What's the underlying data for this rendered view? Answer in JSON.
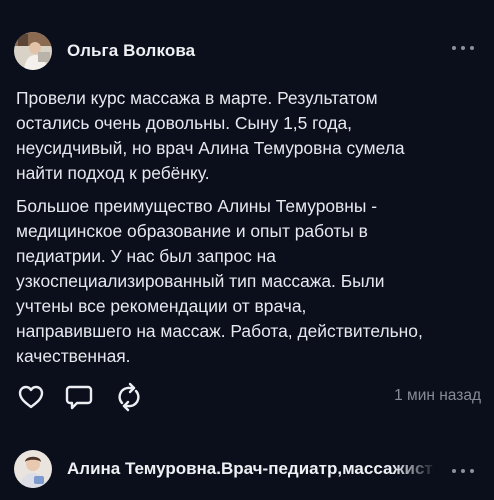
{
  "post": {
    "author": "Ольга Волкова",
    "paragraph1": "Провели курс массажа в марте. Результатом\nостались очень довольны. Сыну 1,5 года,\nнеусидчивый, но врач Алина Темуровна сумела\nнайти подход к ребёнку.",
    "paragraph2": "Большое преимущество Алины Темуровны -\nмедицинское образование и опыт работы в\nпедиатрии. У нас был запрос на\nузкоспециализированный тип массажа. Были\nучтены все рекомендации от врача,\nнаправившего на массаж. Работа, действительно,\nкачественная.",
    "timestamp": "1 мин назад"
  },
  "next_post": {
    "author": "Алина Темуровна.Врач-педиатр,массажист"
  },
  "icons": {
    "more": "more-dots-icon",
    "like": "heart-icon",
    "comment": "comment-bubble-icon",
    "repost": "repost-arrows-icon"
  },
  "colors": {
    "background": "#0b0f1c",
    "text": "#e7e9ee",
    "muted": "#868b96"
  }
}
